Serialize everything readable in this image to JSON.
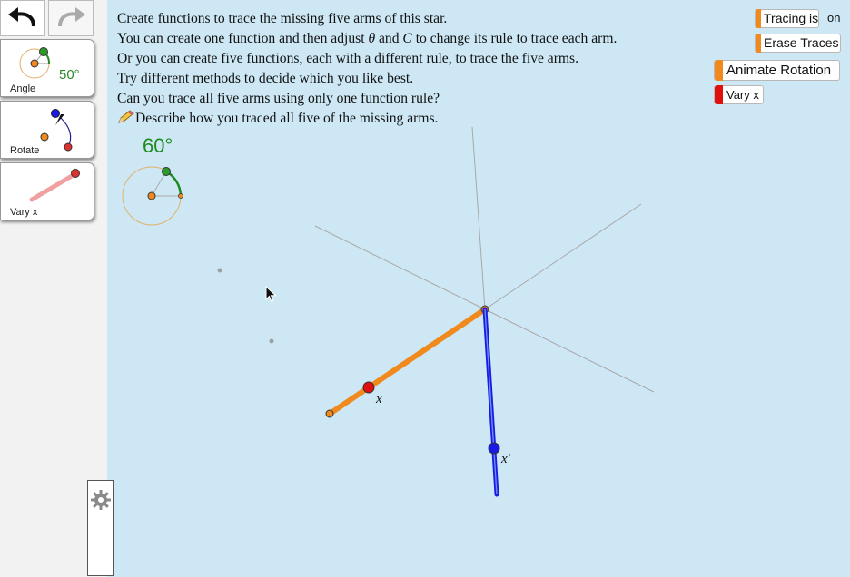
{
  "toolbar": {
    "undo_icon": "undo-arrow-icon",
    "redo_icon": "redo-arrow-icon",
    "tools": [
      {
        "label": "Angle",
        "value": "50°"
      },
      {
        "label": "Rotate"
      },
      {
        "label": "Vary x"
      }
    ],
    "settings_icon": "gear-icon"
  },
  "instructions": {
    "line1": "Create functions to trace the missing five arms of this star.",
    "line2a": "You can create one function and then adjust ",
    "line2_theta": "θ",
    "line2b": " and ",
    "line2_c": "C",
    "line2c": " to change its rule to trace each arm.",
    "line3": "Or you can create five functions, each with a different rule, to trace the five arms.",
    "line4": "Try different methods to decide which you like best.",
    "line5": "Can you trace all five arms using only one function rule?",
    "line6": "Describe how you traced all five of the missing arms."
  },
  "buttons": {
    "tracing": "Tracing is",
    "tracing_state": "on",
    "erase": "Erase Traces",
    "animate": "Animate Rotation",
    "vary": "Vary x"
  },
  "angle": {
    "value": "60°"
  },
  "labels": {
    "x": "x",
    "x_prime": "x′"
  },
  "colors": {
    "background": "#cde8f4",
    "orange": "#f08a1e",
    "blue": "#1a1ae6",
    "red": "#e01010",
    "green": "#1f8a1f"
  }
}
